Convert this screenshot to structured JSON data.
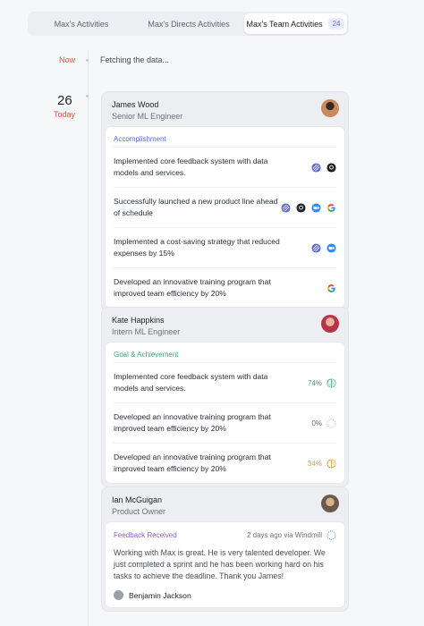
{
  "tabs": [
    {
      "label": "Max's Activities"
    },
    {
      "label": "Max's Directs Activities"
    },
    {
      "label": "Max's Team Activities",
      "badge": "24"
    }
  ],
  "timeline": {
    "now_label": "Now",
    "fetch_text": "Fetching the data...",
    "day_number": "26",
    "day_label": "Today"
  },
  "cards": [
    {
      "name": "James Wood",
      "role": "Senior ML Engineer",
      "section": "Accomplishment",
      "section_color": "#5b6ad6",
      "rows": [
        {
          "text": "Implemented core feedback system with data models and services.",
          "icons": [
            "linear-icon",
            "github-icon"
          ]
        },
        {
          "text": "Successfully launched a new product line ahead of schedule",
          "icons": [
            "linear-icon",
            "github-icon",
            "zoom-icon",
            "google-icon"
          ]
        },
        {
          "text": "Implemented a cost-saving strategy that reduced expenses by 15%",
          "icons": [
            "linear-icon",
            "zoom-icon"
          ]
        },
        {
          "text": "Developed an innovative training program that improved team efficiency by 20%",
          "icons": [
            "google-icon"
          ]
        }
      ]
    },
    {
      "name": "Kate Happkins",
      "role": "Intern ML Engineer",
      "section": "Goal & Achievement",
      "section_color": "#3fa672",
      "rows": [
        {
          "text": "Implemented core feedback system with data models and services.",
          "percent": "74%",
          "percent_value": 0.74,
          "color": "#3fa672"
        },
        {
          "text": "Developed an innovative training program that improved team efficiency by 20%",
          "percent": "0%",
          "percent_value": 0,
          "color": "#6b717c"
        },
        {
          "text": "Developed an innovative training program that improved team efficiency by 20%",
          "percent": "34%",
          "percent_value": 0.34,
          "color": "#d9a23b"
        }
      ]
    },
    {
      "name": "Ian McGuigan",
      "role": "Product Owner",
      "section": "Feedback Received",
      "section_color": "#8b5cc9",
      "meta": "2 days ago via Windmill",
      "feedback": "Working with Max is great. He is very talented developer. We just completed a sprint and he has been working hard on his tasks to achieve the deadline. Thank you James!",
      "author": "Benjamin Jackson"
    }
  ]
}
